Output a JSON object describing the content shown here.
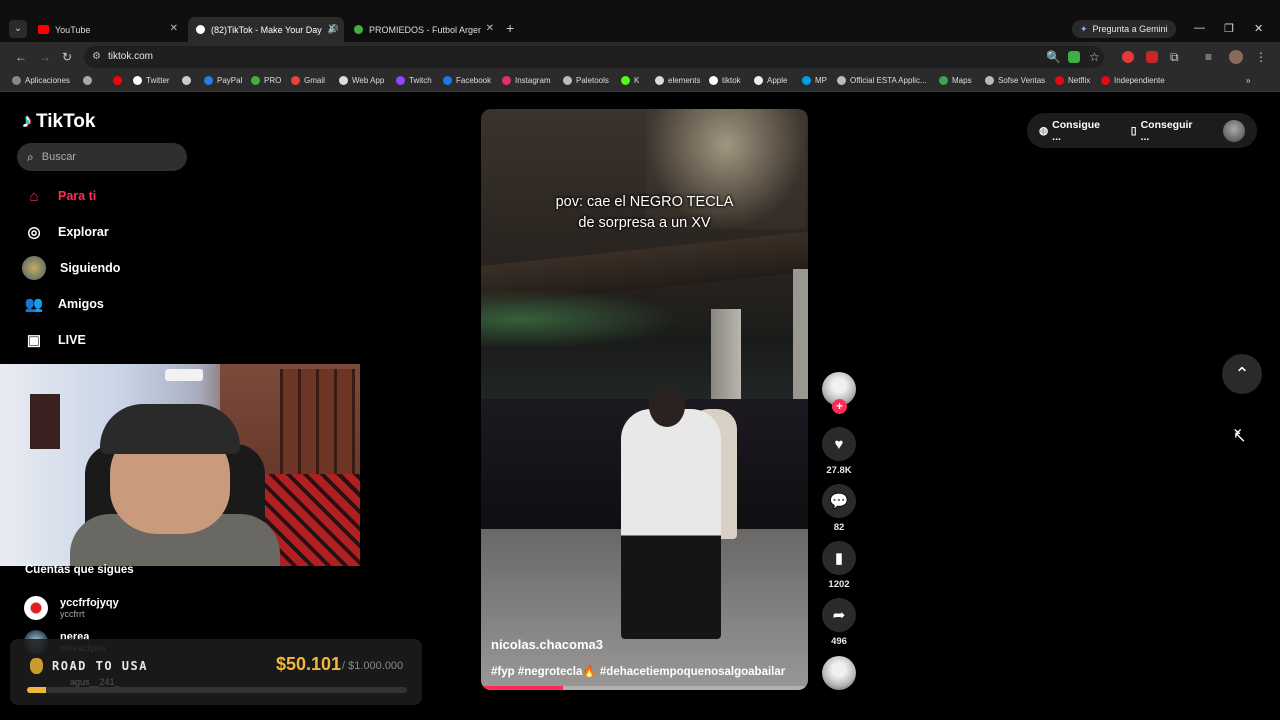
{
  "browser": {
    "tabs": [
      {
        "title": "YouTube",
        "favicon_color": "#ff0000",
        "active": false
      },
      {
        "title": "(82)TikTok - Make Your Day",
        "favicon_color": "#ffffff",
        "active": true
      },
      {
        "title": "PROMIEDOS - Futbol Argentino",
        "favicon_color": "#3cb043",
        "active": false
      }
    ],
    "gemini_label": "Pregunta a Gemini",
    "url": "tiktok.com",
    "bookmarks": [
      {
        "label": "Aplicaciones",
        "color": "#888888"
      },
      {
        "label": "",
        "color": "#aaaaaa"
      },
      {
        "label": "",
        "color": "#ff0000"
      },
      {
        "label": "Twitter",
        "color": "#ffffff"
      },
      {
        "label": "",
        "color": "#cccccc"
      },
      {
        "label": "PayPal",
        "color": "#2a7be4"
      },
      {
        "label": "PRO",
        "color": "#3cb043"
      },
      {
        "label": "Gmail",
        "color": "#ea4335"
      },
      {
        "label": "Web App",
        "color": "#dddddd"
      },
      {
        "label": "Twitch",
        "color": "#9146ff"
      },
      {
        "label": "Facebook",
        "color": "#1877f2"
      },
      {
        "label": "Instagram",
        "color": "#e1306c"
      },
      {
        "label": "Paletools",
        "color": "#bbbbbb"
      },
      {
        "label": "K",
        "color": "#53fc18"
      },
      {
        "label": "elements",
        "color": "#dddddd"
      },
      {
        "label": "tiktok",
        "color": "#ffffff"
      },
      {
        "label": "Apple",
        "color": "#eeeeee"
      },
      {
        "label": "MP",
        "color": "#009ee3"
      },
      {
        "label": "Official ESTA Applic...",
        "color": "#bbbbbb"
      },
      {
        "label": "Maps",
        "color": "#34a853"
      },
      {
        "label": "Sofse Ventas",
        "color": "#bbbbbb"
      },
      {
        "label": "Netflix",
        "color": "#e50914"
      },
      {
        "label": "Independiente",
        "color": "#e50914"
      }
    ]
  },
  "tiktok": {
    "logo": "TikTok",
    "search_placeholder": "Buscar",
    "nav": [
      {
        "label": "Para ti",
        "icon": "home-icon",
        "active": true
      },
      {
        "label": "Explorar",
        "icon": "compass-icon",
        "active": false
      },
      {
        "label": "Siguiendo",
        "icon": "following-avatar-icon",
        "active": false
      },
      {
        "label": "Amigos",
        "icon": "friends-icon",
        "active": false
      },
      {
        "label": "LIVE",
        "icon": "live-icon",
        "active": false
      }
    ],
    "following_title": "Cuentas que sigues",
    "following": [
      {
        "name": "yccfrfojyqy",
        "handle": "yccfrrt"
      },
      {
        "name": "nerea",
        "handle": "nereaclipss"
      },
      {
        "name": "",
        "handle": "agus__241_"
      }
    ],
    "video": {
      "caption_line1": "pov: cae el NEGRO TECLA",
      "caption_line2": "de sorpresa a un XV",
      "username": "nicolas.chacoma3",
      "hashtags": "#fyp #negrotecla🔥 #dehacetiempoquenosalgoabailar",
      "progress": 0.25
    },
    "actions": {
      "likes": "27.8K",
      "comments": "82",
      "saves": "1202",
      "shares": "496"
    },
    "top_right": {
      "coins_label": "Consigue ...",
      "app_label": "Conseguir ..."
    }
  },
  "overlay": {
    "road_label": "ROAD TO USA",
    "amount": "$50.101",
    "goal": "/ $1.000.000",
    "progress": 0.05
  }
}
